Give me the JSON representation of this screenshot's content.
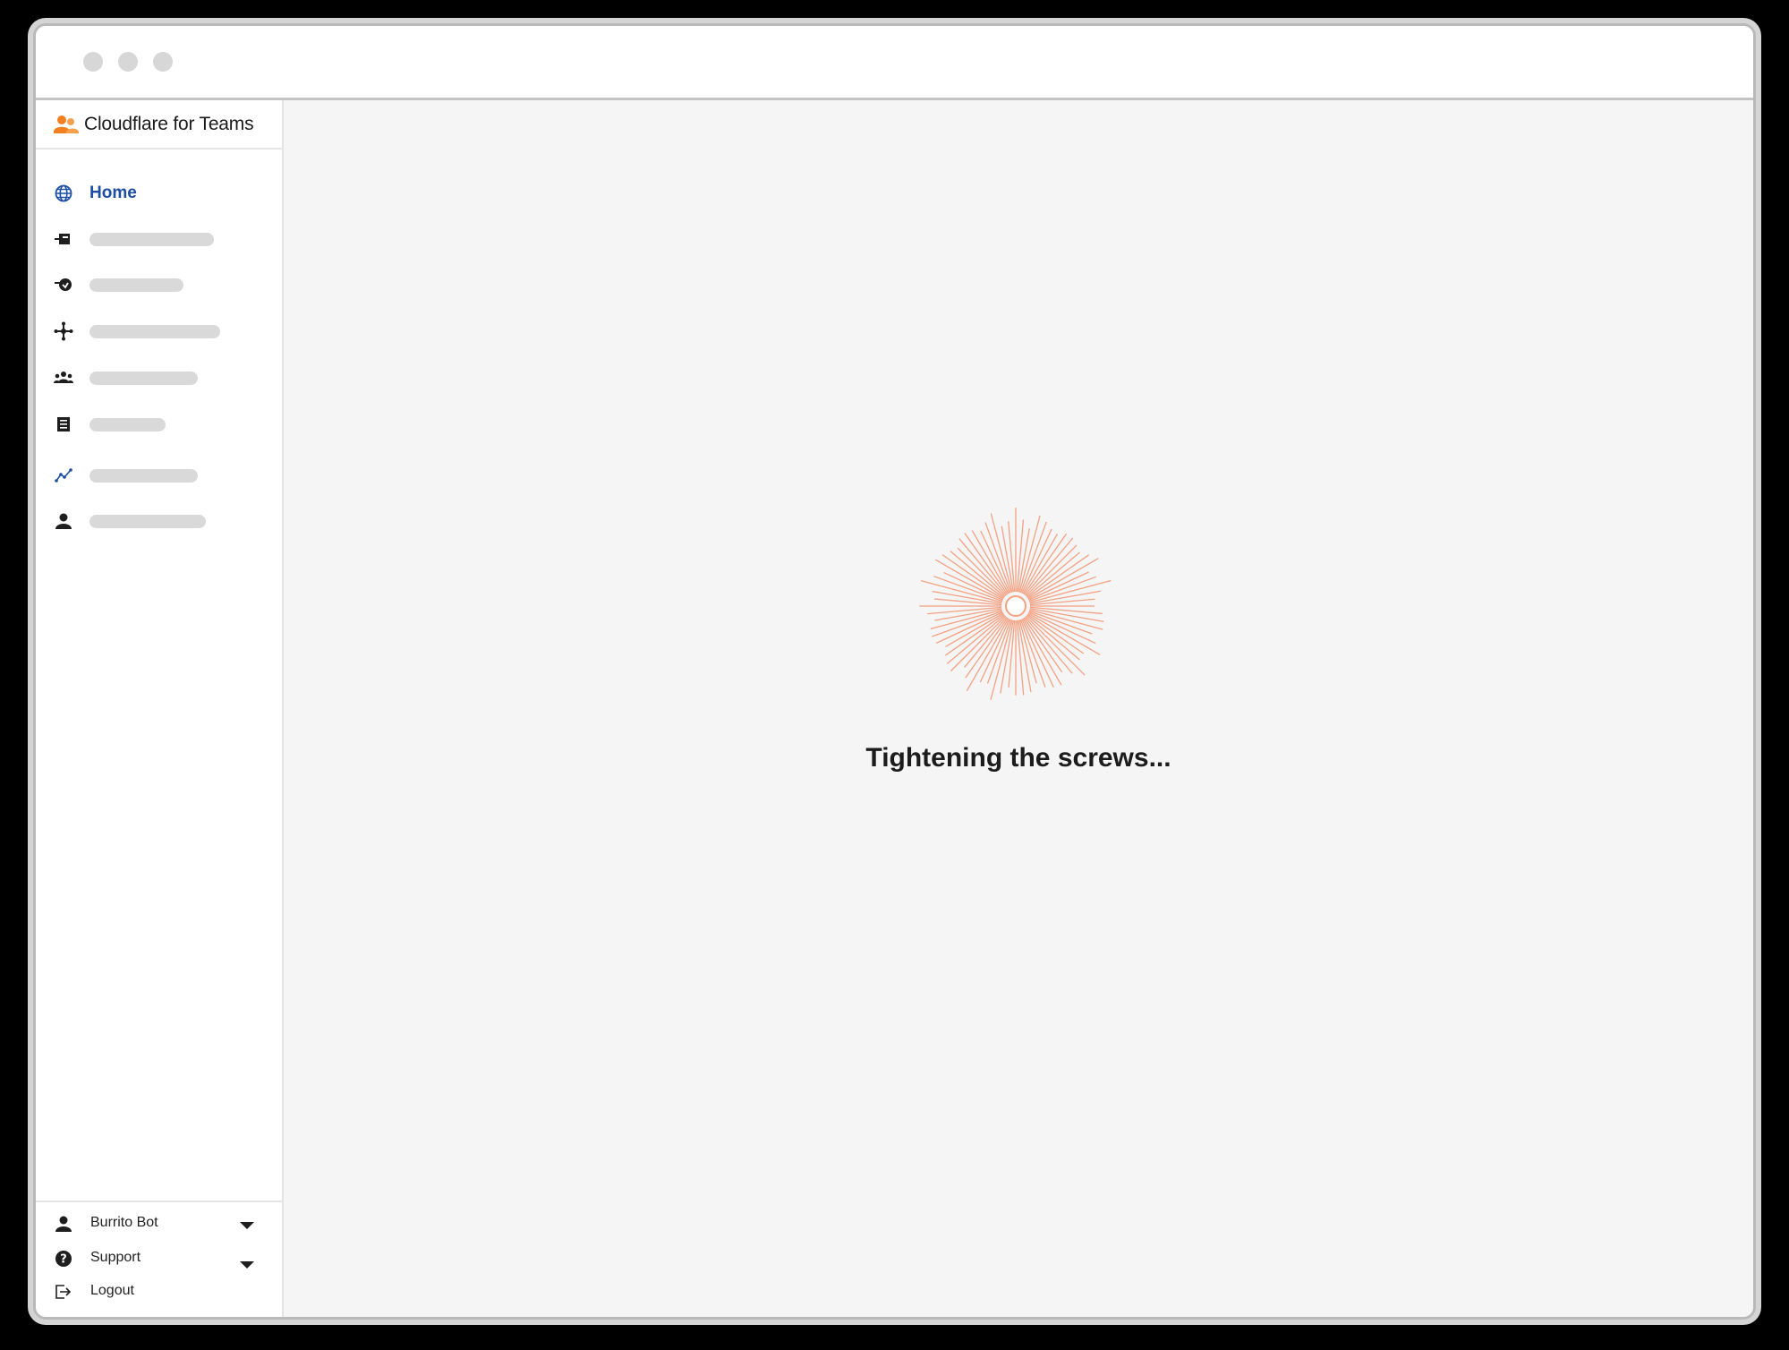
{
  "window": {
    "controls": [
      "close-dot",
      "minimize-dot",
      "maximize-dot"
    ]
  },
  "brand": {
    "name": "Cloudflare for Teams",
    "icon": "users-icon",
    "color": "#f38020"
  },
  "sidebar": {
    "active_color": "#1d4ea3",
    "items": [
      {
        "label": "Home",
        "icon": "globe-icon",
        "active": true
      },
      {
        "label": "",
        "icon": "gateway-icon",
        "loading": true
      },
      {
        "label": "",
        "icon": "access-icon",
        "loading": true
      },
      {
        "label": "",
        "icon": "network-icon",
        "loading": true
      },
      {
        "label": "",
        "icon": "team-icon",
        "loading": true
      },
      {
        "label": "",
        "icon": "logs-icon",
        "loading": true
      },
      {
        "label": "",
        "icon": "analytics-icon",
        "loading": true
      },
      {
        "label": "",
        "icon": "user-icon",
        "loading": true
      }
    ],
    "footer": {
      "account": {
        "label": "Burrito Bot",
        "icon": "user-icon"
      },
      "support": {
        "label": "Support",
        "icon": "help-icon"
      },
      "logout": {
        "label": "Logout",
        "icon": "logout-icon"
      }
    }
  },
  "main": {
    "loading_text": "Tightening the screws...",
    "spinner_color": "#f4a182",
    "background": "#f5f5f5"
  }
}
